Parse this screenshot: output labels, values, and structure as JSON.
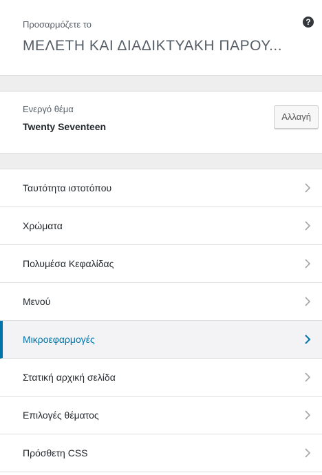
{
  "header": {
    "subtitle": "Προσαρμόζετε το",
    "title": "ΜΕΛΕΤΗ ΚΑΙ ΔΙΑΔΙΚΤΥΑΚΗ ΠΑΡΟΥ...",
    "help_icon": "?"
  },
  "theme": {
    "label": "Ενεργό θέμα",
    "name": "Twenty Seventeen",
    "change_label": "Αλλαγή"
  },
  "menu": {
    "items": [
      {
        "label": "Ταυτότητα ιστοτόπου",
        "active": false
      },
      {
        "label": "Χρώματα",
        "active": false
      },
      {
        "label": "Πολυμέσα Κεφαλίδας",
        "active": false
      },
      {
        "label": "Μενού",
        "active": false
      },
      {
        "label": "Μικροεφαρμογές",
        "active": true
      },
      {
        "label": "Στατική αρχική σελίδα",
        "active": false
      },
      {
        "label": "Επιλογές θέματος",
        "active": false
      },
      {
        "label": "Πρόσθετη CSS",
        "active": false
      }
    ]
  },
  "colors": {
    "accent": "#0073aa",
    "chevron": "#a0a5aa",
    "section_gap": "#eeeeee"
  },
  "icons": {
    "help": "help-icon",
    "chevron": "chevron-right-icon"
  }
}
